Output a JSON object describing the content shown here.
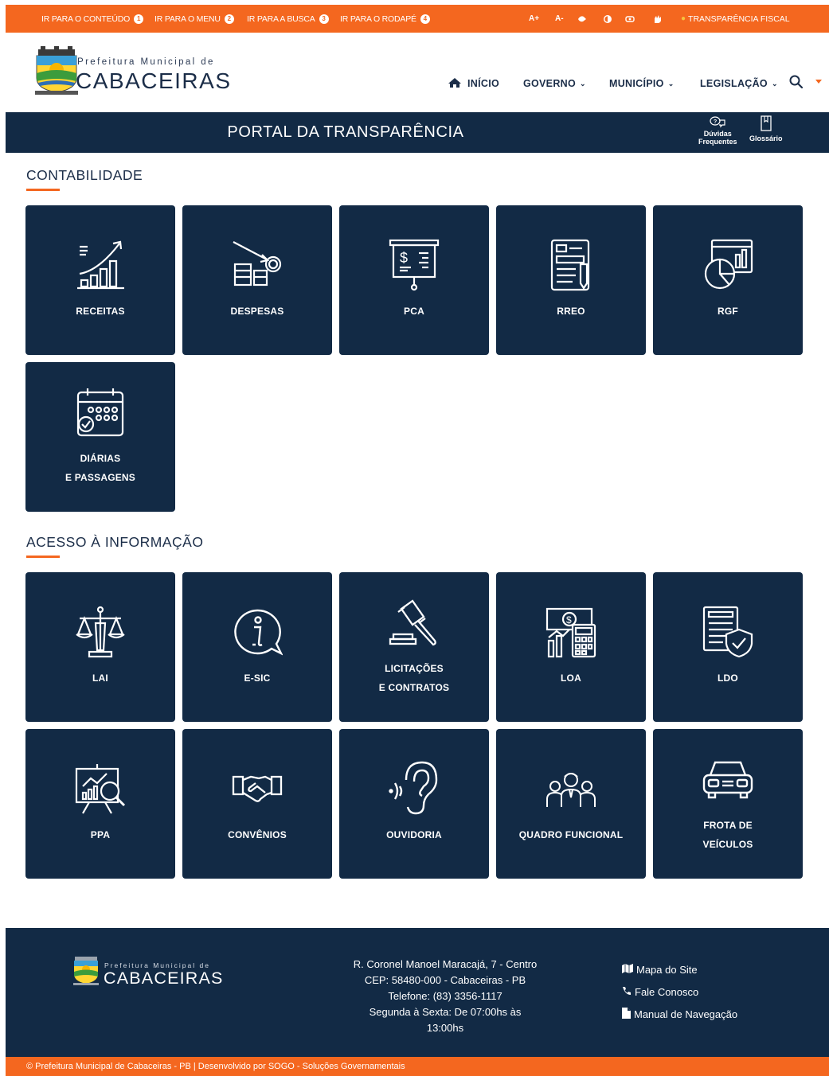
{
  "topbar": {
    "skip_links": [
      {
        "label": "IR PARA O CONTEÚDO",
        "num": "1"
      },
      {
        "label": "IR PARA O MENU",
        "num": "2"
      },
      {
        "label": "IR PARA A BUSCA",
        "num": "3"
      },
      {
        "label": "IR PARA O RODAPÉ",
        "num": "4"
      }
    ],
    "font_increase": "A+",
    "font_decrease": "A-",
    "transparencia_fiscal": "TRANSPARÊNCIA FISCAL"
  },
  "header": {
    "brand_small": "Prefeitura Municipal de",
    "brand_big": "CABACEIRAS",
    "nav": {
      "inicio": "INÍCIO",
      "governo": "GOVERNO",
      "municipio": "MUNICÍPIO",
      "legislacao": "LEGISLAÇÃO"
    }
  },
  "portal": {
    "title": "PORTAL DA TRANSPARÊNCIA",
    "faq_line1": "Dúvidas",
    "faq_line2": "Frequentes",
    "glossario": "Glossário"
  },
  "sections": {
    "contabilidade": {
      "title": "CONTABILIDADE",
      "cards": {
        "receitas": "RECEITAS",
        "despesas": "DESPESAS",
        "pca": "PCA",
        "rreo": "RREO",
        "rgf": "RGF",
        "diarias_1": "DIÁRIAS",
        "diarias_2": "E PASSAGENS"
      }
    },
    "acesso": {
      "title": "ACESSO À INFORMAÇÃO",
      "cards": {
        "lai": "LAI",
        "esic": "E-SIC",
        "licitacoes_1": "LICITAÇÕES",
        "licitacoes_2": "E CONTRATOS",
        "loa": "LOA",
        "ldo": "LDO",
        "ppa": "PPA",
        "convenios": "CONVÊNIOS",
        "ouvidoria": "OUVIDORIA",
        "quadro": "QUADRO FUNCIONAL",
        "frota_1": "FROTA DE",
        "frota_2": "VEÍCULOS"
      }
    }
  },
  "footer": {
    "brand_small": "Prefeitura Municipal de",
    "brand_big": "CABACEIRAS",
    "address": "R. Coronel Manoel Maracajá, 7 - Centro",
    "cep": "CEP: 58480-000 - Cabaceiras - PB",
    "phone": "Telefone: (83) 3356-1117",
    "hours_1": "Segunda à Sexta: De 07:00hs às",
    "hours_2": "13:00hs",
    "links": {
      "mapa": "Mapa do Site",
      "fale": "Fale Conosco",
      "manual": "Manual de Navegação"
    },
    "copyright": "© Prefeitura Municipal de Cabaceiras - PB | Desenvolvido por SOGO - Soluções Governamentais"
  },
  "colors": {
    "accent": "#f4671f",
    "navy": "#122a45"
  }
}
